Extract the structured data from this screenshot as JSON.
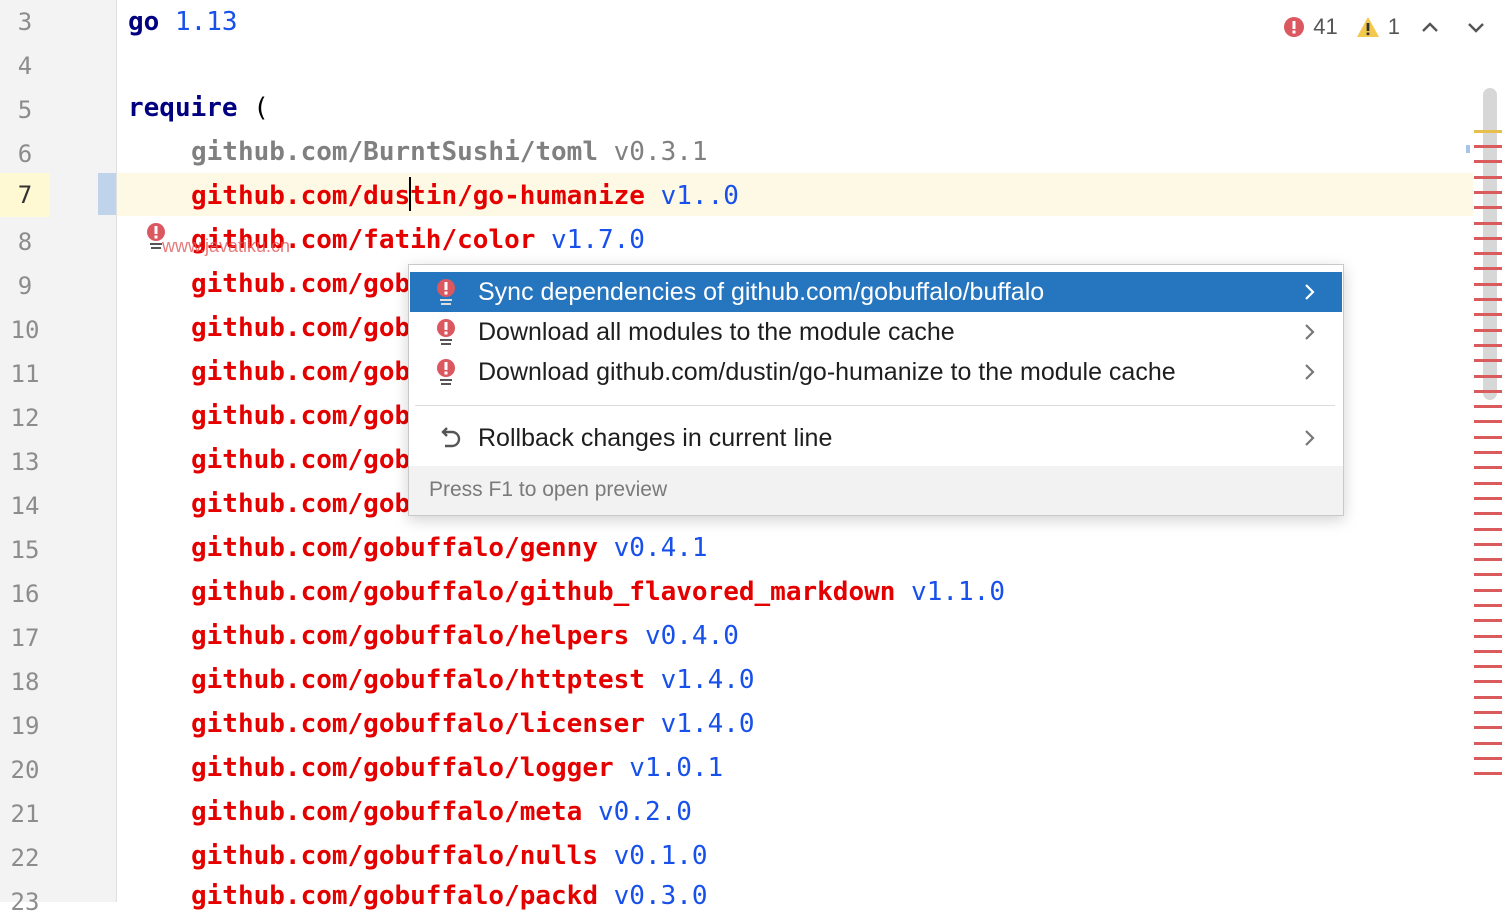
{
  "editor": {
    "line_numbers": [
      "3",
      "4",
      "5",
      "6",
      "7",
      "8",
      "9",
      "10",
      "11",
      "12",
      "13",
      "14",
      "15",
      "16",
      "17",
      "18",
      "19",
      "20",
      "21",
      "22",
      "23"
    ],
    "lines": {
      "l3": {
        "kw": "go",
        "ver": " 1.13"
      },
      "l5": {
        "kw": "require",
        "rest": " ("
      },
      "l6": {
        "pkg": "github.com/BurntSushi/toml",
        "ver": " v0.3.1"
      },
      "l7": {
        "pkg": "github.com/dustin/go-humanize",
        "ver": " v1..0"
      },
      "l8": {
        "pkg": "github.com/fatih/color",
        "ver": " v1.7.0"
      },
      "l9": {
        "pkg": "github.com/gob"
      },
      "l10": {
        "pkg": "github.com/gob"
      },
      "l11": {
        "pkg": "github.com/gob"
      },
      "l12": {
        "pkg": "github.com/gob"
      },
      "l13": {
        "pkg": "github.com/gob"
      },
      "l14": {
        "pkg": "github.com/gob"
      },
      "l15": {
        "pkg": "github.com/gobuffalo/genny",
        "ver": " v0.4.1"
      },
      "l16": {
        "pkg": "github.com/gobuffalo/github_flavored_markdown",
        "ver": " v1.1.0"
      },
      "l17": {
        "pkg": "github.com/gobuffalo/helpers",
        "ver": " v0.4.0"
      },
      "l18": {
        "pkg": "github.com/gobuffalo/httptest",
        "ver": " v1.4.0"
      },
      "l19": {
        "pkg": "github.com/gobuffalo/licenser",
        "ver": " v1.4.0"
      },
      "l20": {
        "pkg": "github.com/gobuffalo/logger",
        "ver": " v1.0.1"
      },
      "l21": {
        "pkg": "github.com/gobuffalo/meta",
        "ver": " v0.2.0"
      },
      "l22": {
        "pkg": "github.com/gobuffalo/nulls",
        "ver": " v0.1.0"
      },
      "l23": {
        "pkg": "github.com/gobuffalo/packd",
        "ver": " v0.3.0"
      }
    }
  },
  "watermark": "www.javatiku.cn",
  "inspections": {
    "errors": "41",
    "warnings": "1"
  },
  "intention_popup": {
    "items": [
      {
        "label": "Sync dependencies of github.com/gobuffalo/buffalo",
        "icon": "error-bulb-icon"
      },
      {
        "label": "Download all modules to the module cache",
        "icon": "error-bulb-icon"
      },
      {
        "label": "Download github.com/dustin/go-humanize to the module cache",
        "icon": "error-bulb-icon"
      },
      {
        "label": "Rollback changes in current line",
        "icon": "rollback-icon"
      }
    ],
    "footer": "Press F1 to open preview"
  },
  "colors": {
    "selection": "#2675bf",
    "error": "#e50000",
    "version": "#1750eb",
    "keyword": "#000080"
  }
}
